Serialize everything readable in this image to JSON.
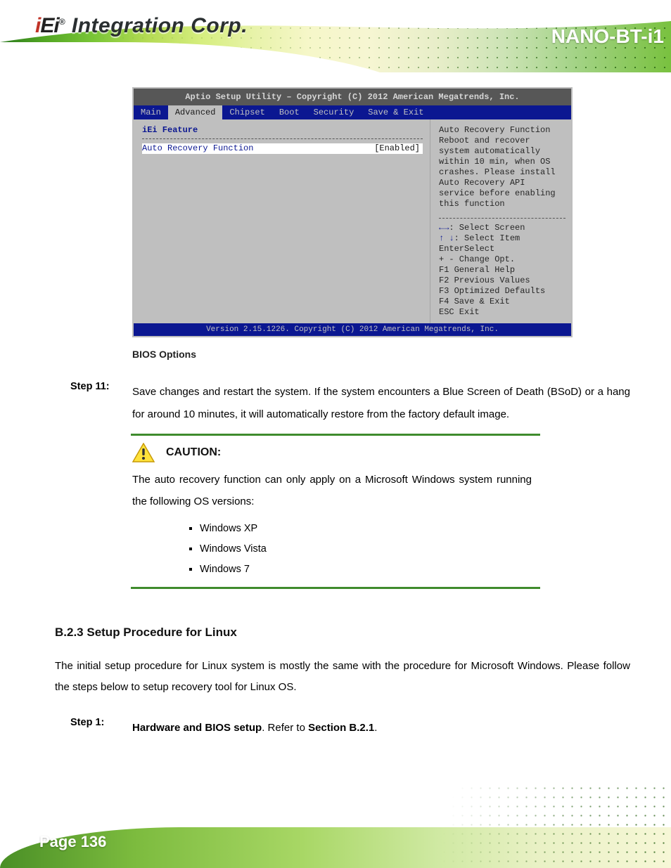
{
  "banner": {
    "product_title": "NANO-BT-i1",
    "logo_text_1": "i",
    "logo_text_2": "E",
    "logo_text_3": "i",
    "logo_reg": "®",
    "logo_tag": "Integration Corp."
  },
  "bios": {
    "title": "Aptio Setup Utility – Copyright (C) 2012 American Megatrends, Inc.",
    "tabs": [
      "Main",
      "Advanced",
      "Chipset",
      "Boot",
      "Security",
      "Save & Exit"
    ],
    "left": {
      "group": "iEi Feature",
      "item_name": "Auto Recovery Function",
      "item_value": "[Enabled]"
    },
    "right": {
      "help1": "Auto Recovery Function",
      "help2": "Reboot and recover",
      "help3": "system automatically",
      "help4": "within 10 min, when OS",
      "help5": "crashes. Please install",
      "help6": "Auto Recovery API",
      "help7": "service before enabling",
      "help8": "this function",
      "k_lr_label": ": Select Screen",
      "k_ud_label": ": Select Item",
      "k_enter": "EnterSelect",
      "k_pm": "+ - Change Opt.",
      "k_f1": "F1  General Help",
      "k_f2": "F2  Previous Values",
      "k_f3": "F3  Optimized Defaults",
      "k_f4": "F4  Save & Exit",
      "k_esc": "ESC Exit"
    },
    "footer": "Version 2.15.1226. Copyright (C) 2012 American Megatrends, Inc.",
    "caption": "BIOS Options"
  },
  "step11": {
    "label": "Step 11:",
    "text": "Save changes and restart the system. If the system encounters a Blue Screen of Death (BSoD) or a hang for around 10 minutes, it will automatically restore from the factory default image."
  },
  "caution": {
    "label": "CAUTION:",
    "intro": "The auto recovery function can only apply on a Microsoft Windows system running the following OS versions:",
    "items": [
      "Windows XP",
      "Windows Vista",
      "Windows 7"
    ]
  },
  "linux_section": {
    "heading": "B.2.3 Setup Procedure for Linux",
    "body": "The initial setup procedure for Linux system is mostly the same with the procedure for Microsoft Windows. Please follow the steps below to setup recovery tool for Linux OS.",
    "step1_label": "Step 1:",
    "step1_body_a": "Hardware and BIOS setup",
    "step1_body_b": ". Refer to ",
    "step1_body_c": "Section B.2.1",
    "step1_body_d": "."
  },
  "footer": {
    "page_number": "Page 136"
  }
}
